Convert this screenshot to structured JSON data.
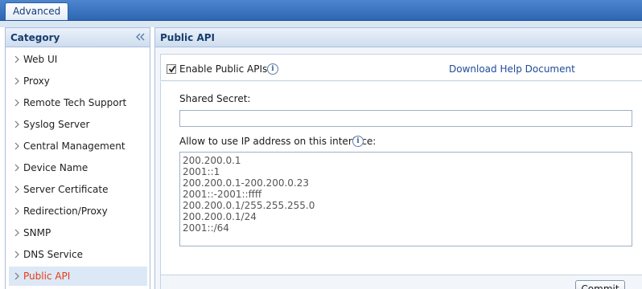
{
  "tabs": {
    "active_label": "Advanced"
  },
  "sidebar": {
    "title": "Category",
    "items": [
      {
        "label": "Web UI"
      },
      {
        "label": "Proxy"
      },
      {
        "label": "Remote Tech Support"
      },
      {
        "label": "Syslog Server"
      },
      {
        "label": "Central Management"
      },
      {
        "label": "Device Name"
      },
      {
        "label": "Server Certificate"
      },
      {
        "label": "Redirection/Proxy"
      },
      {
        "label": "SNMP"
      },
      {
        "label": "DNS Service"
      },
      {
        "label": "Public API",
        "active": true
      }
    ]
  },
  "main": {
    "title": "Public API",
    "enable_label": "Enable Public APIs",
    "enable_checked": true,
    "help_link": "Download Help Document",
    "secret_label": "Shared Secret:",
    "secret_value": "",
    "ip_label": "Allow to use IP address on this interface:",
    "ip_value": "200.200.0.1\n2001::1\n200.200.0.1-200.200.0.23\n2001::-2001::ffff\n200.200.0.1/255.255.255.0\n200.200.0.1/24\n2001::/64",
    "commit_label": "Commit"
  },
  "icons": {
    "info": "info-icon",
    "collapse": "double-chevron-left-icon",
    "item": "chevron-right-icon"
  },
  "colors": {
    "accent": "#2e66b2",
    "active_item": "#e63b12",
    "link": "#1f4a98"
  }
}
